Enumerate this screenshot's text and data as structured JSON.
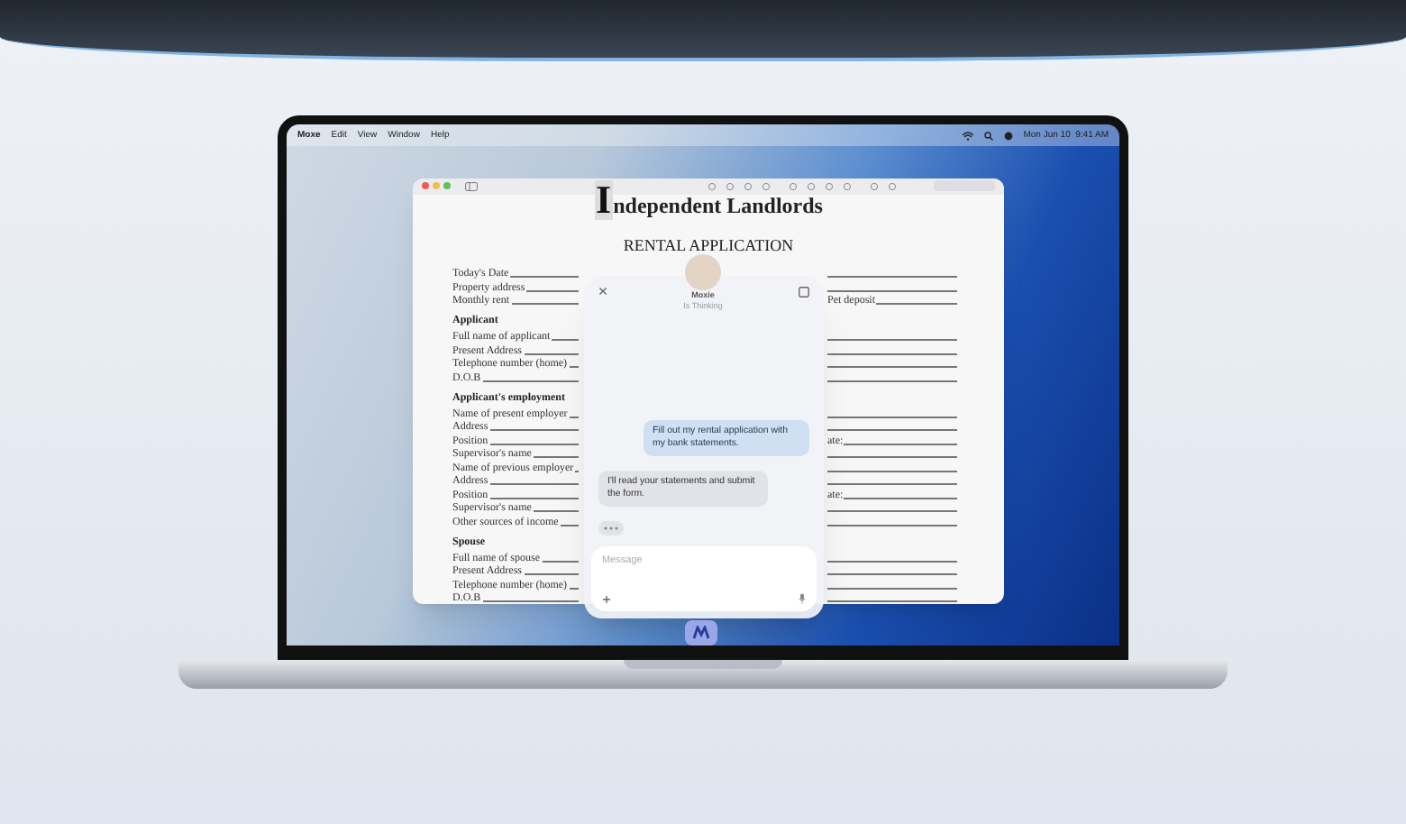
{
  "menu_bar": {
    "items": [
      "Moxe",
      "Edit",
      "View",
      "Window",
      "Help"
    ],
    "clock": "Mon Jun 10  9:41 AM"
  },
  "document": {
    "logo": {
      "initial": "I",
      "rest": "ndependent Landlords"
    },
    "title": "RENTAL APPLICATION",
    "sections": [
      {
        "fields": [
          "Today's Date",
          "Property address",
          "Monthly rent"
        ]
      },
      {
        "heading": "Applicant",
        "fields": [
          "Full name of applicant",
          "Present Address",
          "Telephone number (home)",
          "D.O.B"
        ]
      },
      {
        "heading": "Applicant's employment",
        "fields": [
          "Name of present employer",
          "Address",
          "Position",
          "Supervisor's name",
          "Name of previous employer",
          "Address",
          "Position",
          "Supervisor's name",
          "Other sources of income"
        ]
      },
      {
        "heading": "Spouse",
        "fields": [
          "Full name of spouse",
          "Present Address",
          "Telephone number (home)",
          "D.O.B"
        ]
      }
    ],
    "right_column": [
      {
        "rows": [
          "",
          "",
          "Pet deposit"
        ]
      },
      {
        "rows": [
          "",
          "",
          "",
          ""
        ]
      },
      {
        "rows": [
          "",
          "",
          "ate:",
          "",
          "",
          "",
          "ate:",
          "",
          ""
        ]
      },
      {
        "rows": [
          "",
          "",
          "",
          ""
        ]
      }
    ]
  },
  "chat": {
    "assistant": {
      "name": "Moxie",
      "status": "Is Thinking"
    },
    "messages": [
      {
        "kind": "user",
        "text": "Fill out my rental application with my bank statements."
      },
      {
        "kind": "assistant",
        "text": "I'll read your statements and submit the form."
      }
    ],
    "typing": true,
    "input": {
      "placeholder": "Message"
    }
  }
}
